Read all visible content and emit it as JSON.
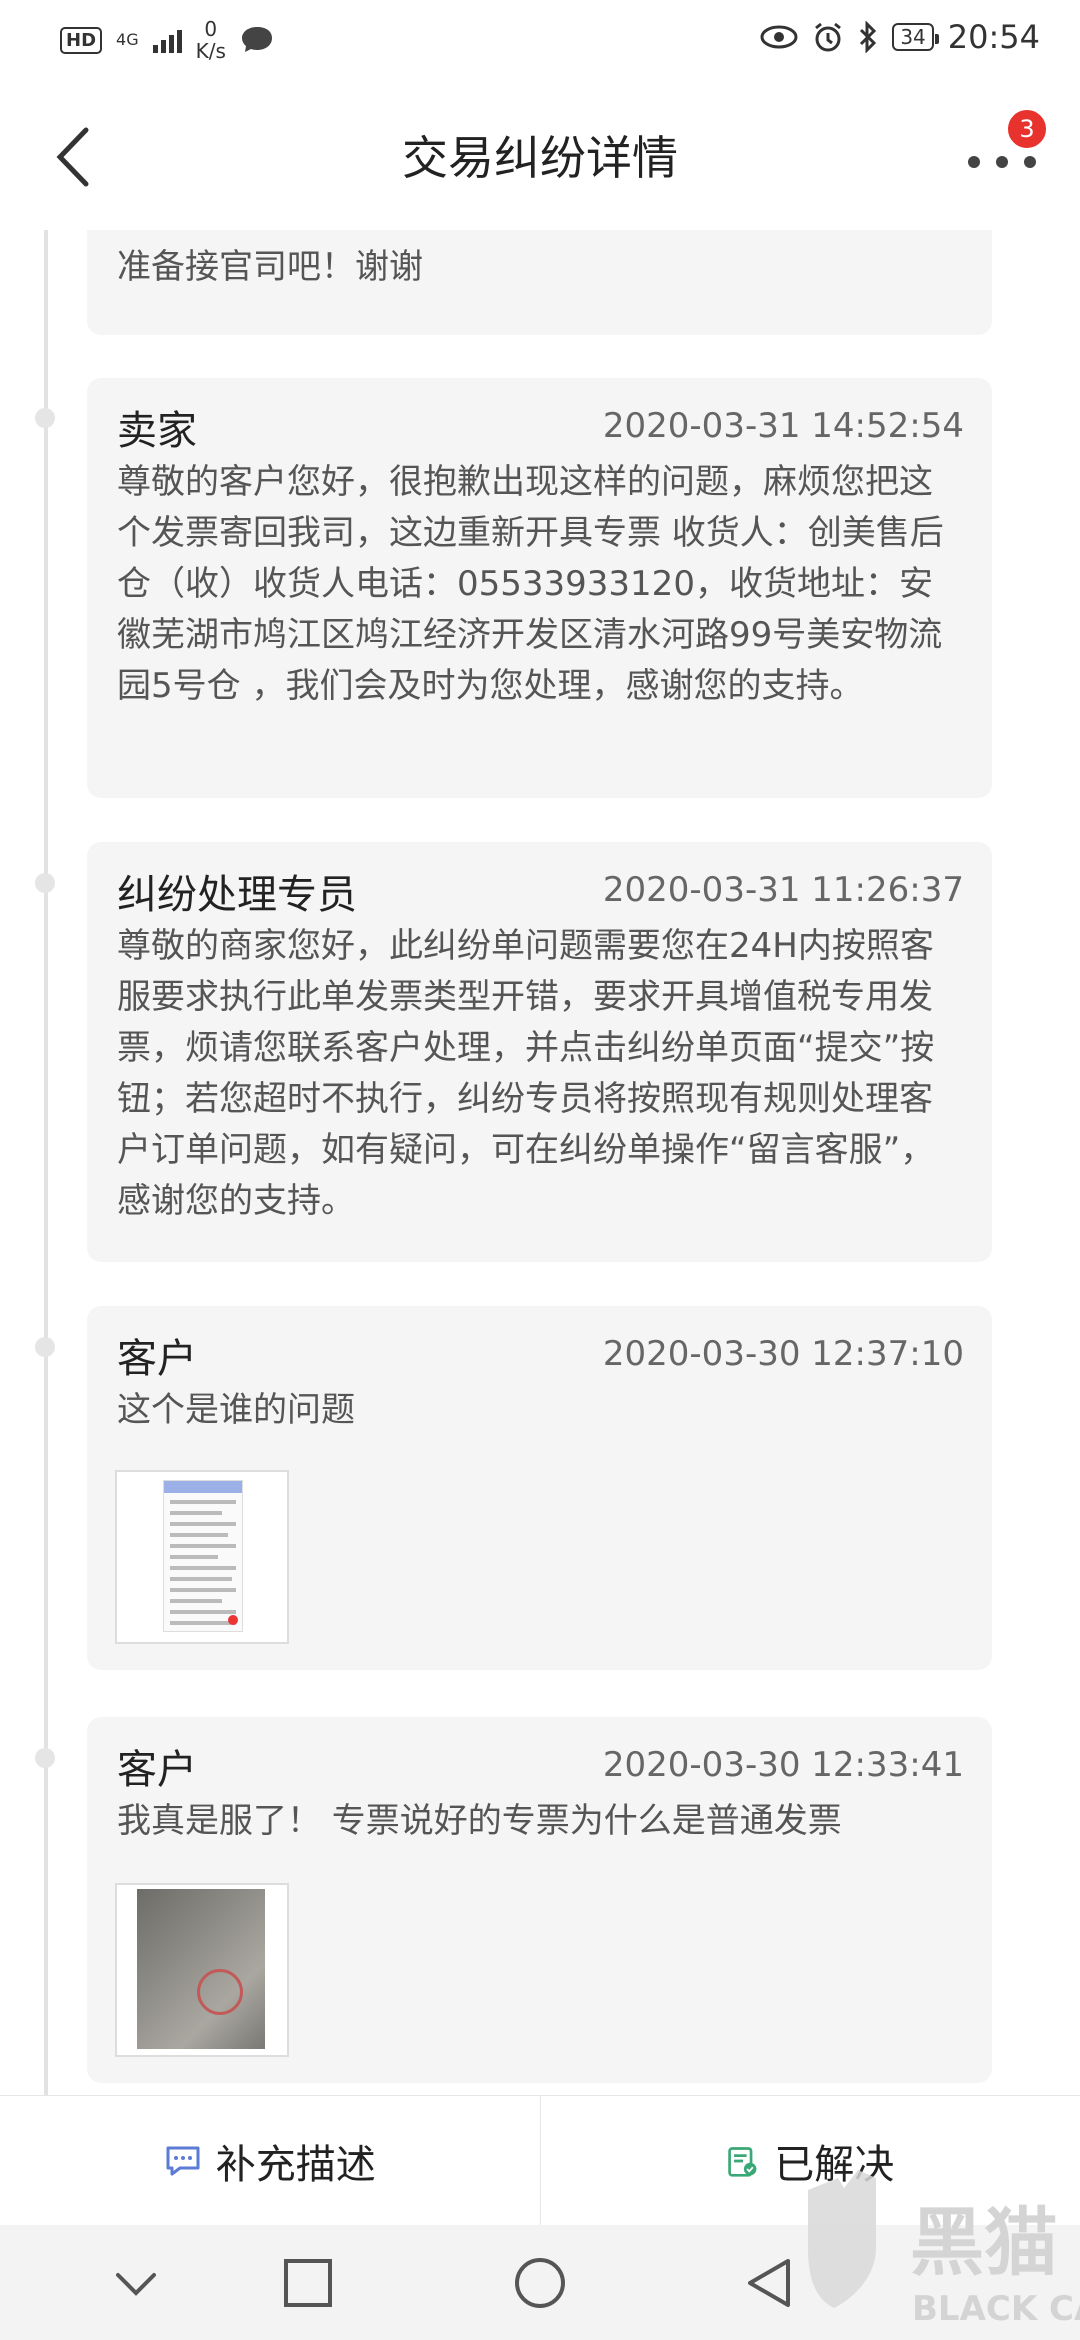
{
  "status_bar": {
    "hd": "HD",
    "network": "4G",
    "speed_value": "0",
    "speed_unit": "K/s",
    "battery": "34",
    "time": "20:54"
  },
  "header": {
    "title": "交易纠纷详情",
    "notification_count": "3"
  },
  "messages": [
    {
      "text": "准备接官司吧！谢谢"
    },
    {
      "name": "卖家",
      "time": "2020-03-31 14:52:54",
      "text": "尊敬的客户您好，很抱歉出现这样的问题，麻烦您把这个发票寄回我司，这边重新开具专票 收货人：创美售后仓（收）收货人电话：05533933120，收货地址：安徽芜湖市鸠江区鸠江经济开发区清水河路99号美安物流园5号仓 ，我们会及时为您处理，感谢您的支持。"
    },
    {
      "name": "纠纷处理专员",
      "time": "2020-03-31 11:26:37",
      "text": "尊敬的商家您好，此纠纷单问题需要您在24H内按照客服要求执行此单发票类型开错，要求开具增值税专用发票，烦请您联系客户处理，并点击纠纷单页面“提交”按钮；若您超时不执行，纠纷专员将按照现有规则处理客户订单问题，如有疑问，可在纠纷单操作“留言客服”，感谢您的支持。"
    },
    {
      "name": "客户",
      "time": "2020-03-30 12:37:10",
      "text": "这个是谁的问题"
    },
    {
      "name": "客户",
      "time": "2020-03-30 12:33:41",
      "text": "我真是服了！ 专票说好的专票为什么是普通发票"
    }
  ],
  "actions": {
    "supplement": "补充描述",
    "resolved": "已解决"
  },
  "watermark": {
    "cn": "黑猫",
    "en": "BLACK CAT"
  },
  "colors": {
    "badge": "#e8322d",
    "card_bg": "#f5f5f5",
    "icon_blue": "#5b7bd5",
    "icon_green": "#3aa876"
  }
}
